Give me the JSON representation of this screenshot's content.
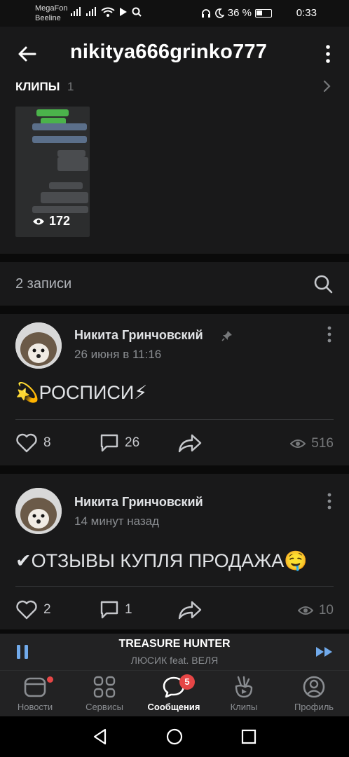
{
  "status_bar": {
    "carrier1": "MegaFon",
    "carrier2": "Beeline",
    "battery": "36 %",
    "time": "0:33"
  },
  "header": {
    "title": "nikitya666grinko777"
  },
  "clips": {
    "heading": "КЛИПЫ",
    "count": "1",
    "thumb_views": "172"
  },
  "posts_section": {
    "count_label": "2 записи"
  },
  "posts": [
    {
      "author": "Никита Гринчовский",
      "date": "26 июня в 11:16",
      "text": "💫РОСПИСИ⚡",
      "likes": "8",
      "comments": "26",
      "views": "516",
      "pinned": true
    },
    {
      "author": "Никита Гринчовский",
      "date": "14 минут назад",
      "text": "✔ОТЗЫВЫ КУПЛЯ ПРОДАЖА🤤",
      "likes": "2",
      "comments": "1",
      "views": "10",
      "pinned": false
    }
  ],
  "player": {
    "track": "TREASURE HUNTER",
    "artist": "ЛЮСИК feat. ВЕЛЯ"
  },
  "tabbar": {
    "tabs": [
      {
        "label": "Новости",
        "icon": "news-icon"
      },
      {
        "label": "Сервисы",
        "icon": "services-icon"
      },
      {
        "label": "Сообщения",
        "icon": "messages-icon",
        "badge": "5"
      },
      {
        "label": "Клипы",
        "icon": "clips-icon"
      },
      {
        "label": "Профиль",
        "icon": "profile-icon"
      }
    ]
  },
  "colors": {
    "background": "#0a0a0a",
    "surface": "#19191a",
    "accent": "#71aaeb",
    "badge": "#e64646"
  }
}
